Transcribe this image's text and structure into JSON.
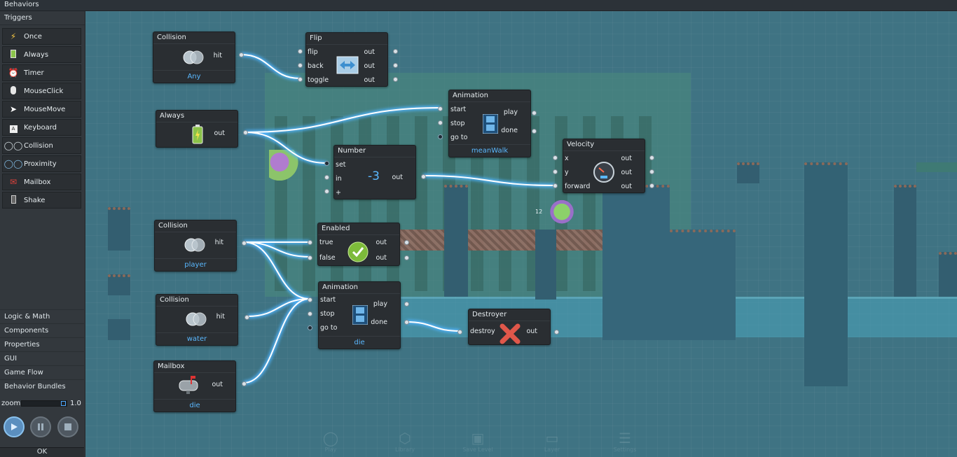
{
  "topbar": {
    "title": "Behaviors"
  },
  "sidebar": {
    "triggers_label": "Triggers",
    "triggers": [
      {
        "label": "Once",
        "icon": "lightning-icon"
      },
      {
        "label": "Always",
        "icon": "battery-icon"
      },
      {
        "label": "Timer",
        "icon": "alarm-clock-icon"
      },
      {
        "label": "MouseClick",
        "icon": "mouse-icon"
      },
      {
        "label": "MouseMove",
        "icon": "cursor-icon"
      },
      {
        "label": "Keyboard",
        "icon": "key-icon"
      },
      {
        "label": "Collision",
        "icon": "collision-icon"
      },
      {
        "label": "Proximity",
        "icon": "proximity-icon"
      },
      {
        "label": "Mailbox",
        "icon": "mailbox-icon"
      },
      {
        "label": "Shake",
        "icon": "phone-icon"
      }
    ],
    "categories": [
      "Logic & Math",
      "Components",
      "Properties",
      "GUI",
      "Game Flow",
      "Behavior Bundles"
    ],
    "zoom_label": "zoom",
    "zoom_value": "1.0",
    "ok_label": "OK"
  },
  "nodes": {
    "collision_any": {
      "title": "Collision",
      "out": "hit",
      "sub": "Any"
    },
    "flip": {
      "title": "Flip",
      "in": [
        "flip",
        "back",
        "toggle"
      ],
      "out": [
        "out",
        "out",
        "out"
      ]
    },
    "always": {
      "title": "Always",
      "out": "out"
    },
    "anim_walk": {
      "title": "Animation",
      "in": [
        "start",
        "stop",
        "go to"
      ],
      "out": [
        "play",
        "done"
      ],
      "sub": "meanWalk"
    },
    "number": {
      "title": "Number",
      "in": [
        "set",
        "in",
        "+"
      ],
      "value": "-3",
      "out": "out"
    },
    "velocity": {
      "title": "Velocity",
      "in": [
        "x",
        "y",
        "forward"
      ],
      "out": [
        "out",
        "out",
        "out"
      ]
    },
    "collision_player": {
      "title": "Collision",
      "out": "hit",
      "sub": "player"
    },
    "enabled": {
      "title": "Enabled",
      "in": [
        "true",
        "false"
      ],
      "out": [
        "out",
        "out"
      ]
    },
    "collision_water": {
      "title": "Collision",
      "out": "hit",
      "sub": "water"
    },
    "anim_die": {
      "title": "Animation",
      "in": [
        "start",
        "stop",
        "go to"
      ],
      "out": [
        "play",
        "done"
      ],
      "sub": "die"
    },
    "destroyer": {
      "title": "Destroyer",
      "in": "destroy",
      "out": "out"
    },
    "mailbox": {
      "title": "Mailbox",
      "out": "out",
      "sub": "die"
    }
  },
  "level": {
    "player_label": "12"
  },
  "bottom_nav": [
    "Play",
    "Library",
    "Save Level",
    "Layer",
    "Settings"
  ],
  "colors": {
    "wire": "#ffffff",
    "wire_glow": "#4fb4ff",
    "accent_text": "#5ab8ff",
    "node_bg": "#2a2e32"
  }
}
